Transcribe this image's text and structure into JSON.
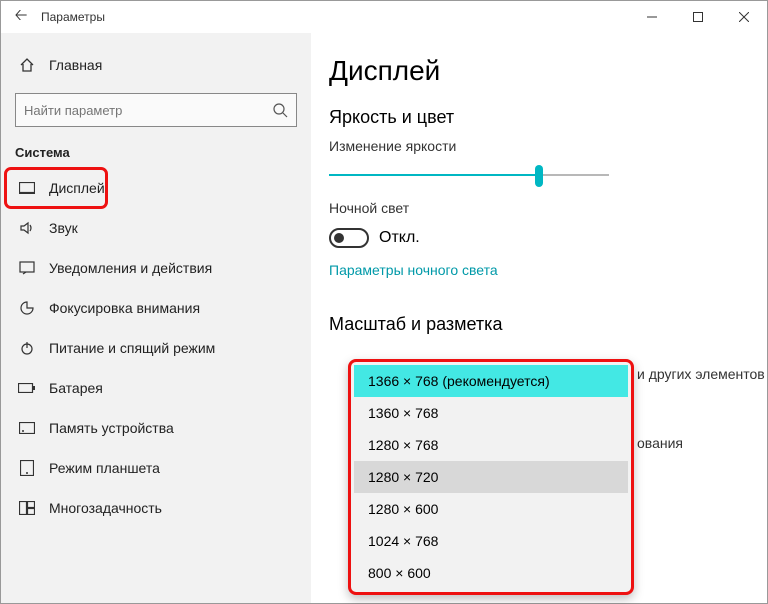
{
  "titlebar": {
    "title": "Параметры"
  },
  "sidebar": {
    "home": "Главная",
    "search_placeholder": "Найти параметр",
    "section": "Система",
    "items": [
      {
        "label": "Дисплей"
      },
      {
        "label": "Звук"
      },
      {
        "label": "Уведомления и действия"
      },
      {
        "label": "Фокусировка внимания"
      },
      {
        "label": "Питание и спящий режим"
      },
      {
        "label": "Батарея"
      },
      {
        "label": "Память устройства"
      },
      {
        "label": "Режим планшета"
      },
      {
        "label": "Многозадачность"
      }
    ]
  },
  "main": {
    "heading": "Дисплей",
    "brightness_section": "Яркость и цвет",
    "brightness_label": "Изменение яркости",
    "nightlight_label": "Ночной свет",
    "toggle_off": "Откл.",
    "nightlight_link": "Параметры ночного света",
    "scale_section": "Масштаб и разметка",
    "cutoff_right": "и других элементов",
    "cutoff_link": "ования"
  },
  "dropdown": {
    "options": [
      "1366 × 768 (рекомендуется)",
      "1360 × 768",
      "1280 × 768",
      "1280 × 720",
      "1280 × 600",
      "1024 × 768",
      "800 × 600"
    ]
  }
}
